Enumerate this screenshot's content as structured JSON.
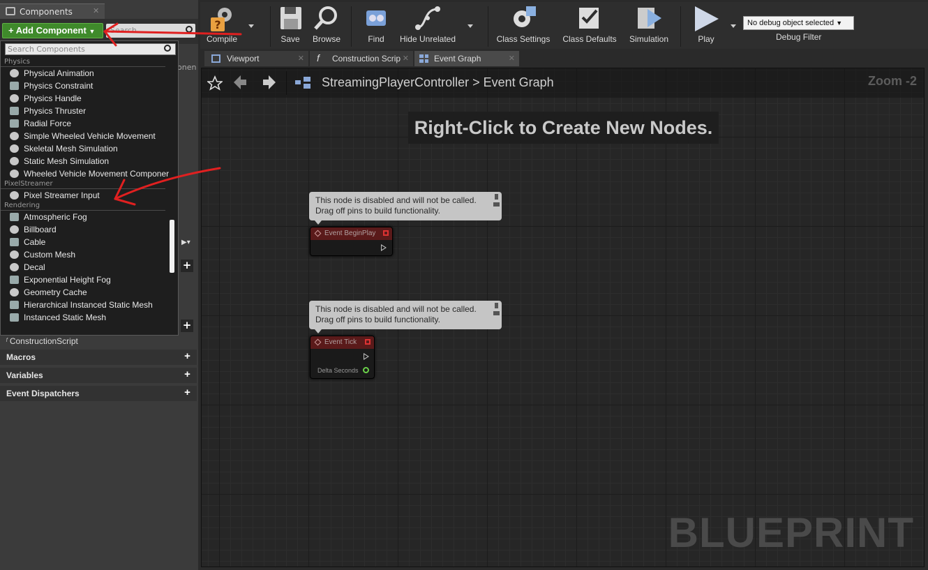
{
  "components_panel": {
    "tab_label": "Components",
    "add_component_label": "+ Add Component",
    "search_placeholder": "Search",
    "hidden_label": "onen"
  },
  "dropdown": {
    "search_placeholder": "Search Components",
    "categories": [
      {
        "name": "Physics",
        "items": [
          "Physical Animation",
          "Physics Constraint",
          "Physics Handle",
          "Physics Thruster",
          "Radial Force",
          "Simple Wheeled Vehicle Movement",
          "Skeletal Mesh Simulation",
          "Static Mesh Simulation",
          "Wheeled Vehicle Movement Componer"
        ]
      },
      {
        "name": "PixelStreamer",
        "items": [
          "Pixel Streamer Input"
        ]
      },
      {
        "name": "Rendering",
        "items": [
          "Atmospheric Fog",
          "Billboard",
          "Cable",
          "Custom Mesh",
          "Decal",
          "Exponential Height Fog",
          "Geometry Cache",
          "Hierarchical Instanced Static Mesh",
          "Instanced Static Mesh"
        ]
      }
    ]
  },
  "my_blueprint": {
    "construction_script": "ConstructionScript",
    "sections": [
      "Macros",
      "Variables",
      "Event Dispatchers"
    ]
  },
  "toolbar": {
    "buttons": [
      "Compile",
      "Save",
      "Browse",
      "Find",
      "Hide Unrelated",
      "Class Settings",
      "Class Defaults",
      "Simulation",
      "Play"
    ],
    "debug_object": "No debug object selected",
    "debug_filter": "Debug Filter"
  },
  "tabs": [
    "Viewport",
    "Construction Scrip",
    "Event Graph"
  ],
  "graph": {
    "breadcrumb_root": "StreamingPlayerController",
    "breadcrumb_sep": ">",
    "breadcrumb_current": "Event Graph",
    "zoom": "Zoom -2",
    "hint": "Right-Click to Create New Nodes.",
    "watermark": "BLUEPRINT",
    "nodes": [
      {
        "comment": "This node is disabled and will not be called.\nDrag off pins to build functionality.",
        "title": "Event BeginPlay"
      },
      {
        "comment": "This node is disabled and will not be called.\nDrag off pins to build functionality.",
        "title": "Event Tick",
        "pin_label": "Delta Seconds"
      }
    ]
  },
  "colors": {
    "add_component": "#3f8a2b",
    "annotation_arrow": "#e02020",
    "event_node_header": "#5a1a1a"
  }
}
